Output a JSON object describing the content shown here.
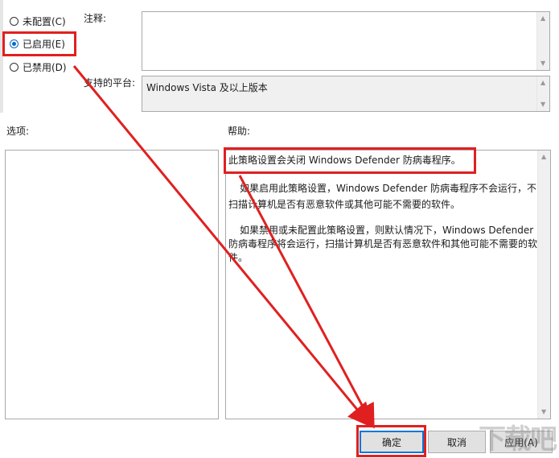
{
  "radios": [
    {
      "label": "未配置(C)",
      "checked": false
    },
    {
      "label": "已启用(E)",
      "checked": true
    },
    {
      "label": "已禁用(D)",
      "checked": false
    }
  ],
  "comment": {
    "label": "注释:",
    "value": ""
  },
  "platform": {
    "label": "支持的平台:",
    "value": "Windows Vista 及以上版本"
  },
  "options": {
    "label": "选项:"
  },
  "help": {
    "label": "帮助:",
    "lines": [
      "此策略设置会关闭 Windows Defender 防病毒程序。",
      "如果启用此策略设置，Windows Defender 防病毒程序不会运行，不",
      "扫描计算机是否有恶意软件或其他可能不需要的软件。",
      "如果禁用或未配置此策略设置，则默认情况下，Windows Defender",
      "防病毒程序将会运行，扫描计算机是否有恶意软件和其他可能不需要的软",
      "件。"
    ]
  },
  "buttons": {
    "ok": "确定",
    "cancel": "取消",
    "apply": "应用(A)"
  },
  "watermark": "下载吧",
  "colors": {
    "annotation": "#e02020",
    "radio_checked": "#0a68c5",
    "default_button_border": "#0078d7"
  }
}
